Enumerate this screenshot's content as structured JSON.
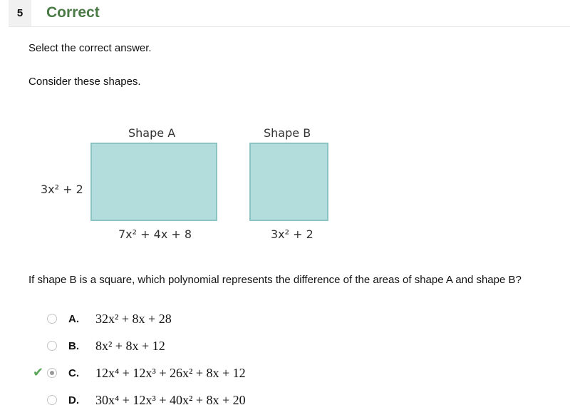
{
  "header": {
    "question_number": "5",
    "status": "Correct"
  },
  "instructions": "Select the correct answer.",
  "prompt": "Consider these shapes.",
  "figure": {
    "shape_a": {
      "title": "Shape A",
      "side_label": "3x² + 2",
      "bottom_label": "7x² + 4x + 8"
    },
    "shape_b": {
      "title": "Shape B",
      "bottom_label": "3x² + 2"
    },
    "fill_color": "#b3dcdd"
  },
  "question": "If shape B is a square, which polynomial represents the difference of the areas of shape A and shape B?",
  "options": [
    {
      "letter": "A.",
      "text": "32x² + 8x + 28",
      "selected": false
    },
    {
      "letter": "B.",
      "text": "8x² + 8x + 12",
      "selected": false
    },
    {
      "letter": "C.",
      "text": "12x⁴ + 12x³ + 26x² + 8x + 12",
      "selected": true,
      "correct": true
    },
    {
      "letter": "D.",
      "text": "30x⁴ + 12x³ + 40x² + 8x + 20",
      "selected": false
    }
  ],
  "icons": {
    "correct": "check-icon"
  }
}
